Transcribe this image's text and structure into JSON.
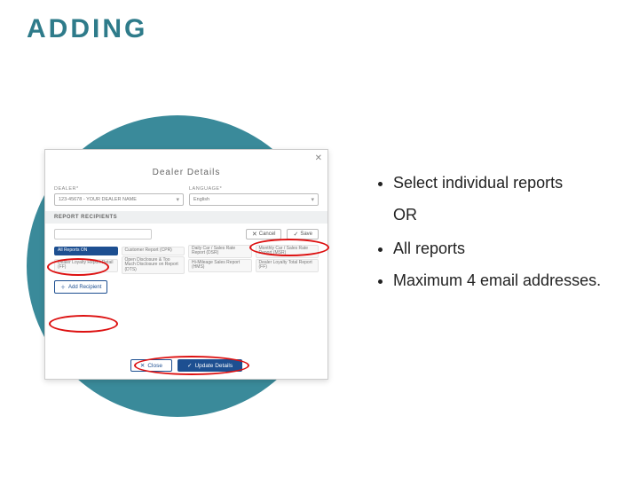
{
  "title": "ADDING",
  "bullets": {
    "b1": "Select individual reports",
    "or": "OR",
    "b2": "All reports",
    "b3": "Maximum 4 email addresses."
  },
  "modal": {
    "heading": "Dealer Details",
    "dealer_label": "DEALER*",
    "language_label": "LANGUAGE*",
    "dealer_value": "123-45678 - YOUR DEALER NAME",
    "language_value": "English",
    "recipients_band": "REPORT RECIPIENTS",
    "cancel": "Cancel",
    "save": "Save",
    "reports": {
      "all": "All Reports ON",
      "r1": "Customer Report (CPR)",
      "r2": "Daily Car / Sales Rate Report (DSR)",
      "r3": "Monthly Car / Sales Rate Report (MSR)",
      "r4": "Open Disclosure & Too Much Disclosure on Report (DTS)",
      "r5": "Hi-Mileage Sales Report (HMS)",
      "r6": "Dealer Loyalty Total Report (FF)",
      "r7": "Dealer Loyalty Report Detail (FF)"
    },
    "add_recipient": "Add Recipient",
    "close": "Close",
    "update": "Update Details"
  }
}
